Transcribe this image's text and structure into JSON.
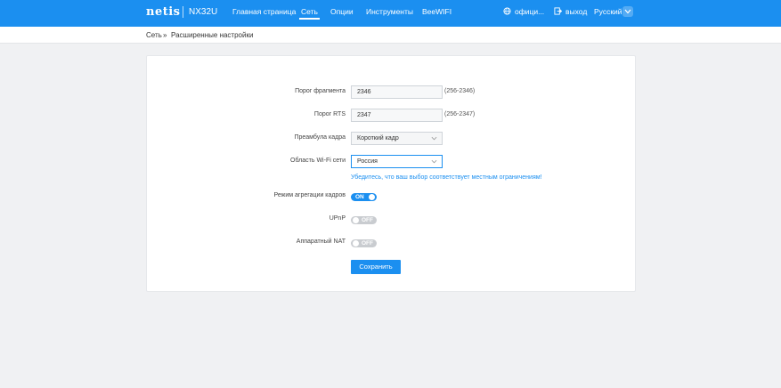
{
  "header": {
    "brand": "netis",
    "model": "NX32U",
    "nav": [
      {
        "label": "Главная страница"
      },
      {
        "label": "Сеть"
      },
      {
        "label": "Опции"
      },
      {
        "label": "Инструменты"
      },
      {
        "label": "BeeWIFI"
      }
    ],
    "official_label": "офици...",
    "logout_label": "выход",
    "language": "Русский",
    "bg_color": "#1b8ff0"
  },
  "breadcrumb": {
    "root": "Сеть",
    "separator": "»",
    "current": "Расширенные настройки"
  },
  "form": {
    "fragment_threshold": {
      "label": "Порог фрагмента",
      "value": "2346",
      "range": "(256-2346)"
    },
    "rts_threshold": {
      "label": "Порог RTS",
      "value": "2347",
      "range": "(256-2347)"
    },
    "preamble": {
      "label": "Преамбула кадра",
      "value": "Короткий кадр"
    },
    "wifi_region": {
      "label": "Область Wi-Fi сети",
      "value": "Россия",
      "notice": "Убедитесь, что ваш выбор соответствует местным ограничениям!"
    },
    "frame_aggregation": {
      "label": "Режим агрегации кадров",
      "state": "ON"
    },
    "upnp": {
      "label": "UPnP",
      "state": "OFF"
    },
    "hardware_nat": {
      "label": "Аппаратный NAT",
      "state": "OFF"
    },
    "save_label": "Сохранить"
  }
}
